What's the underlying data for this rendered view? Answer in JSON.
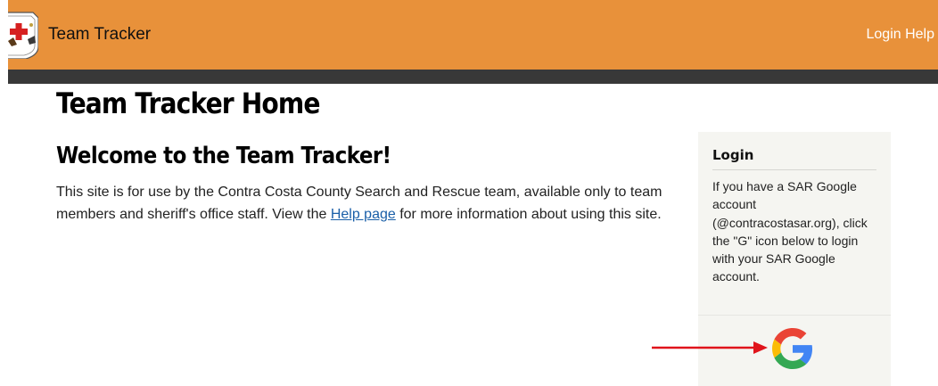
{
  "header": {
    "brand": "Team Tracker",
    "login_help": "Login Help",
    "logo": "sar-badge-logo",
    "accent_color": "#e8913a",
    "dark_strip_color": "#383838"
  },
  "main": {
    "title": "Team Tracker Home",
    "welcome_heading": "Welcome to the Team Tracker!",
    "intro_before_link": "This site is for use by the Contra Costa County Search and Rescue team, available only to team members and sheriff's office staff. View the ",
    "intro_link": "Help page",
    "intro_after_link": " for more information about using this site."
  },
  "login_panel": {
    "heading": "Login",
    "text": "If you have a SAR Google account (@contracostasar.org), click the \"G\" icon below to login with your SAR Google account.",
    "google_icon": "google-g-icon",
    "link_color": "#1a5fa8"
  },
  "annotation": {
    "arrow_color": "#e0141b",
    "arrow_icon": "red-arrow-right-icon"
  }
}
